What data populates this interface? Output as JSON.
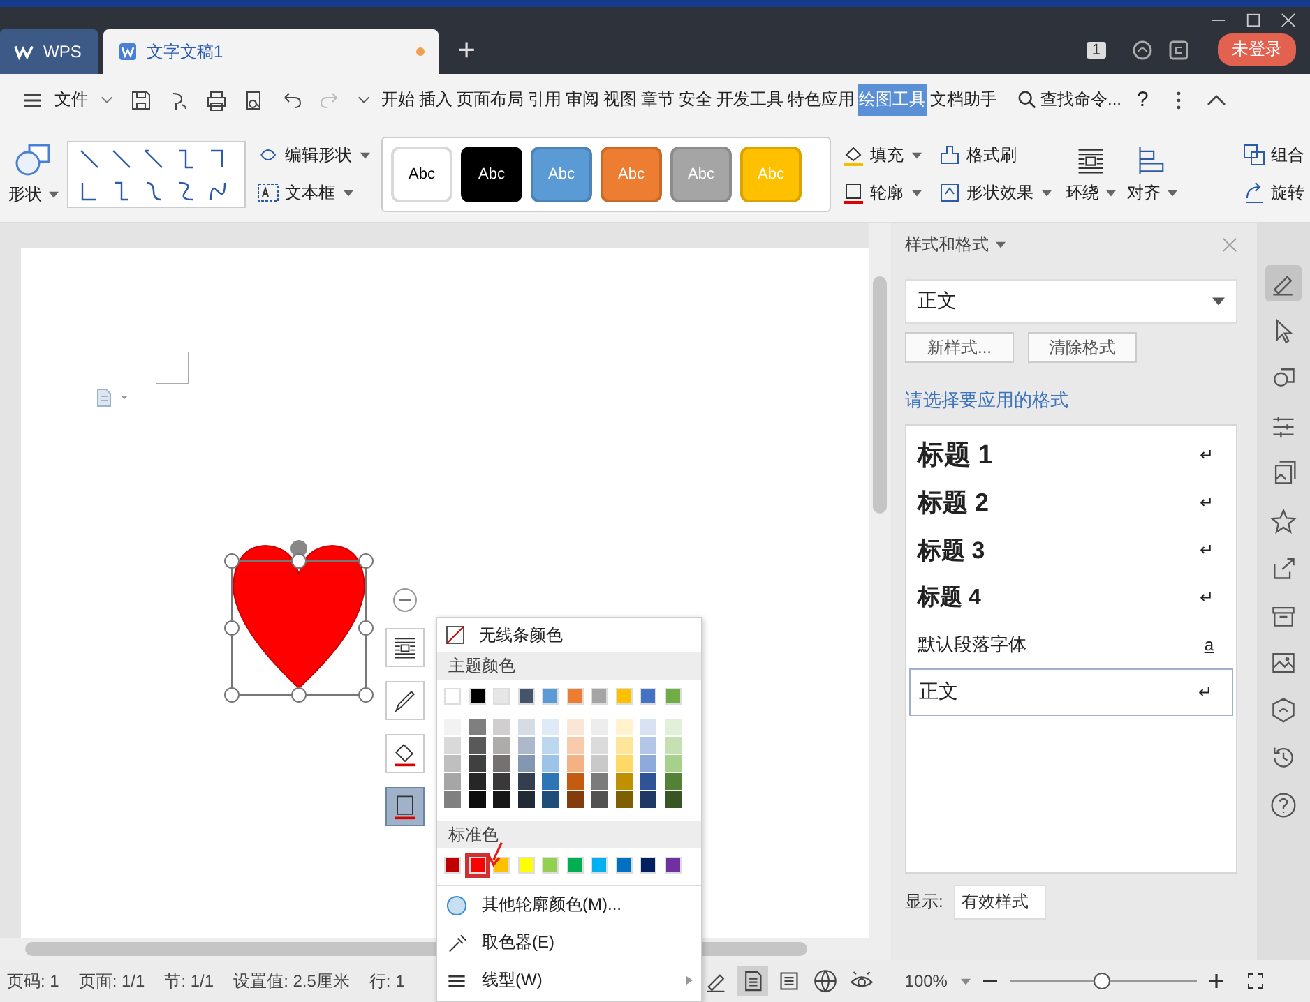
{
  "tabs": [
    {
      "label": "WPS",
      "kind": "home",
      "selected": false,
      "unsaved": false
    },
    {
      "label": "文字文稿1",
      "kind": "document",
      "selected": true,
      "unsaved": true
    }
  ],
  "new_tab": "+",
  "page_badge": "1",
  "login_button": "未登录",
  "menu": {
    "file": "文件",
    "ribbon_tabs": [
      {
        "label": "开始",
        "selected": false
      },
      {
        "label": "插入",
        "selected": false
      },
      {
        "label": "页面布局",
        "selected": false
      },
      {
        "label": "引用",
        "selected": false
      },
      {
        "label": "审阅",
        "selected": false
      },
      {
        "label": "视图",
        "selected": false
      },
      {
        "label": "章节",
        "selected": false
      },
      {
        "label": "安全",
        "selected": false
      },
      {
        "label": "开发工具",
        "selected": false
      },
      {
        "label": "特色应用",
        "selected": false
      },
      {
        "label": "绘图工具",
        "selected": true
      },
      {
        "label": "文档助手",
        "selected": false
      }
    ],
    "search": "查找命令...",
    "help": "?"
  },
  "ribbon": {
    "shape_button": "形状",
    "edit_shape": "编辑形状",
    "text_box": "文本框",
    "styles": [
      {
        "label": "Abc",
        "color": "#ffffff"
      },
      {
        "label": "Abc",
        "color": "#000000"
      },
      {
        "label": "Abc",
        "color": "#5b9bd5"
      },
      {
        "label": "Abc",
        "color": "#ed7d31"
      },
      {
        "label": "Abc",
        "color": "#a5a5a5"
      },
      {
        "label": "Abc",
        "color": "#ffc000"
      }
    ],
    "fill": "填充",
    "format_painter": "格式刷",
    "outline": "轮廓",
    "shape_effects": "形状效果",
    "wrap": "环绕",
    "align": "对齐",
    "group": "组合",
    "rotate": "旋转"
  },
  "float_tools": [
    {
      "kind": "wrap",
      "selected": false
    },
    {
      "kind": "brush",
      "selected": false
    },
    {
      "kind": "fill",
      "selected": false
    },
    {
      "kind": "outline",
      "selected": true
    }
  ],
  "popup": {
    "no_line": "无线条颜色",
    "theme_heading": "主题颜色",
    "theme_colors": [
      {
        "color": "#ffffff"
      },
      {
        "color": "#000000"
      },
      {
        "color": "#e7e6e6"
      },
      {
        "color": "#44546a"
      },
      {
        "color": "#5b9bd5"
      },
      {
        "color": "#ed7d31"
      },
      {
        "color": "#a5a5a5"
      },
      {
        "color": "#ffc000"
      },
      {
        "color": "#4472c4"
      },
      {
        "color": "#70ad47"
      }
    ],
    "shade_rows": [
      [
        {
          "color": "#f2f2f2"
        },
        {
          "color": "#7f7f7f"
        },
        {
          "color": "#d0cece"
        },
        {
          "color": "#d6dce4"
        },
        {
          "color": "#deebf6"
        },
        {
          "color": "#fbe5d5"
        },
        {
          "color": "#ededed"
        },
        {
          "color": "#fff2cc"
        },
        {
          "color": "#d9e2f3"
        },
        {
          "color": "#e2efd9"
        }
      ],
      [
        {
          "color": "#d9d9d9"
        },
        {
          "color": "#595959"
        },
        {
          "color": "#aeabab"
        },
        {
          "color": "#adb9ca"
        },
        {
          "color": "#bdd7ee"
        },
        {
          "color": "#f7cbac"
        },
        {
          "color": "#dbdbdb"
        },
        {
          "color": "#fee599"
        },
        {
          "color": "#b4c6e7"
        },
        {
          "color": "#c5e0b3"
        }
      ],
      [
        {
          "color": "#bfbfbf"
        },
        {
          "color": "#404040"
        },
        {
          "color": "#757171"
        },
        {
          "color": "#8497b0"
        },
        {
          "color": "#9dc3e6"
        },
        {
          "color": "#f4b183"
        },
        {
          "color": "#c9c9c9"
        },
        {
          "color": "#ffd965"
        },
        {
          "color": "#8eaadb"
        },
        {
          "color": "#a8d08d"
        }
      ],
      [
        {
          "color": "#a6a6a6"
        },
        {
          "color": "#262626"
        },
        {
          "color": "#3a3838"
        },
        {
          "color": "#333f4f"
        },
        {
          "color": "#2e75b5"
        },
        {
          "color": "#c55a11"
        },
        {
          "color": "#7b7b7b"
        },
        {
          "color": "#bf9000"
        },
        {
          "color": "#2f5496"
        },
        {
          "color": "#538135"
        }
      ],
      [
        {
          "color": "#808080"
        },
        {
          "color": "#0d0d0d"
        },
        {
          "color": "#171616"
        },
        {
          "color": "#222a35"
        },
        {
          "color": "#1f4e79"
        },
        {
          "color": "#833c0b"
        },
        {
          "color": "#525252"
        },
        {
          "color": "#7f6000"
        },
        {
          "color": "#1f3864"
        },
        {
          "color": "#375623"
        }
      ]
    ],
    "standard_heading": "标准色",
    "standard_colors": [
      {
        "color": "#c00000",
        "selected": false
      },
      {
        "color": "#ff0000",
        "selected": true
      },
      {
        "color": "#ffc000",
        "selected": false
      },
      {
        "color": "#ffff00",
        "selected": false
      },
      {
        "color": "#92d050",
        "selected": false
      },
      {
        "color": "#00b050",
        "selected": false
      },
      {
        "color": "#00b0f0",
        "selected": false
      },
      {
        "color": "#0070c0",
        "selected": false
      },
      {
        "color": "#002060",
        "selected": false
      },
      {
        "color": "#7030a0",
        "selected": false
      }
    ],
    "items": [
      {
        "label": "其他轮廓颜色(M)...",
        "kind": "palette",
        "submenu": false
      },
      {
        "label": "取色器(E)",
        "kind": "picker",
        "submenu": false
      },
      {
        "label": "线型(W)",
        "kind": "linetype",
        "submenu": true
      }
    ]
  },
  "panel": {
    "title": "样式和格式",
    "current_style": "正文",
    "new_style": "新样式...",
    "clear_format": "清除格式",
    "prompt": "请选择要应用的格式",
    "styles": [
      {
        "label": "标题 1",
        "kind": "h1",
        "mark": "↵",
        "selected": false
      },
      {
        "label": "标题 2",
        "kind": "h2",
        "mark": "↵",
        "selected": false
      },
      {
        "label": "标题 3",
        "kind": "h3",
        "mark": "↵",
        "selected": false
      },
      {
        "label": "标题 4",
        "kind": "h4",
        "mark": "↵",
        "selected": false
      },
      {
        "label": "默认段落字体",
        "kind": "font",
        "mark": "a",
        "selected": false
      },
      {
        "label": "正文",
        "kind": "body",
        "mark": "↵",
        "selected": true
      }
    ],
    "show_label": "显示:",
    "show_value": "有效样式"
  },
  "side_tools": [
    {
      "kind": "pen",
      "selected": true
    },
    {
      "kind": "cursor",
      "selected": false
    },
    {
      "kind": "shapes",
      "selected": false
    },
    {
      "kind": "sliders",
      "selected": false
    },
    {
      "kind": "gallery",
      "selected": false
    },
    {
      "kind": "star",
      "selected": false
    },
    {
      "kind": "share",
      "selected": false
    },
    {
      "kind": "archive",
      "selected": false
    },
    {
      "kind": "image",
      "selected": false
    },
    {
      "kind": "shield",
      "selected": false
    },
    {
      "kind": "history",
      "selected": false
    },
    {
      "kind": "help",
      "selected": false
    }
  ],
  "status": {
    "fields": [
      "页码: 1",
      "页面: 1/1",
      "节: 1/1",
      "设置值: 2.5厘米",
      "行: 1"
    ],
    "views": [
      {
        "kind": "pen",
        "selected": false
      },
      {
        "kind": "page",
        "selected": true
      },
      {
        "kind": "outline",
        "selected": false
      },
      {
        "kind": "globe",
        "selected": false
      },
      {
        "kind": "eye",
        "selected": false
      }
    ],
    "zoom": "100%",
    "zoom_slider": {
      "level": 0.49
    }
  }
}
